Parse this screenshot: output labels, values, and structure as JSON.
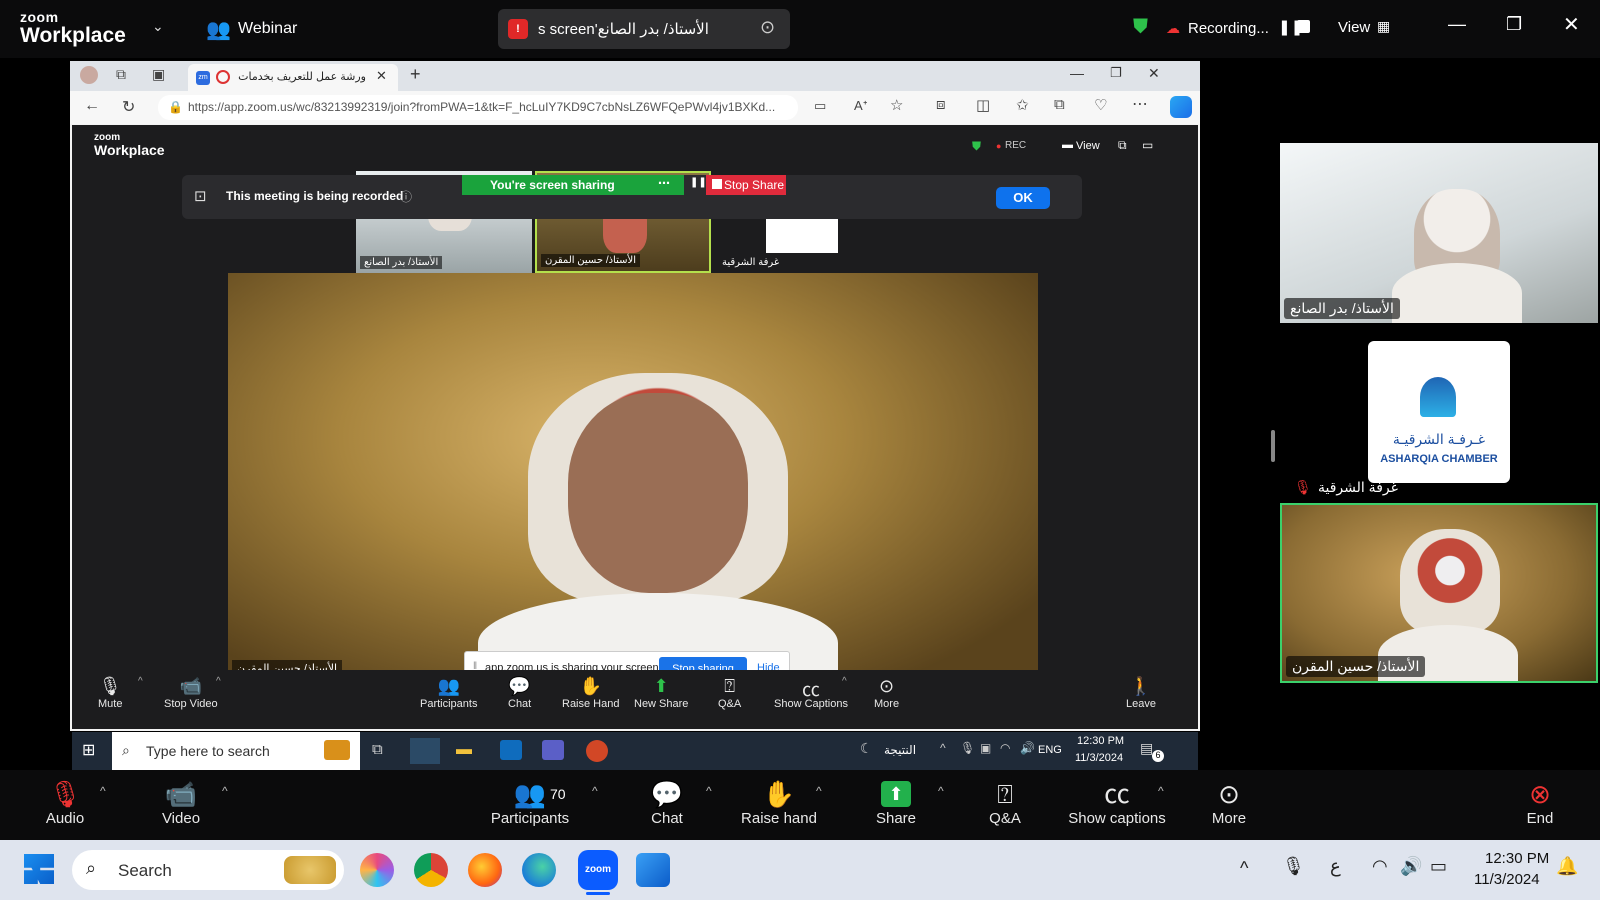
{
  "zoom_top": {
    "logo_top": "zoom",
    "logo_bottom": "Workplace",
    "webinar_label": "Webinar",
    "screen_title": "الأستاذ/ بدر الصانع's screen",
    "recording_label": "Recording...",
    "view_label": "View"
  },
  "browser": {
    "tab_title": "ورشة عمل للتعريف بخدمات",
    "url": "https://app.zoom.us/wc/83213992319/join?fromPWA=1&tk=F_hcLuIY7KD9C7cbNsLZ6WFQePWvl4jv1BXKd..."
  },
  "web_zoom": {
    "logo_top": "zoom",
    "logo_bottom": "Workplace",
    "rec_label": "REC",
    "view_label": "View",
    "sharing_label": "You're screen sharing",
    "stop_share_label": "Stop Share",
    "recorded_notice": "This meeting is being recorded",
    "ok_label": "OK",
    "gallery": [
      {
        "name": "الأستاذ/ بدر الصانع"
      },
      {
        "name": "الأستاذ/ حسين المقرن"
      },
      {
        "name": "غرفة الشرقية"
      }
    ],
    "speaker_name": "الأستاذ/ حسين المقرن",
    "share_notice": "app.zoom.us is sharing your screen.",
    "stop_sharing_label": "Stop sharing",
    "hide_label": "Hide",
    "toolbar": {
      "mute": "Mute",
      "stop_video": "Stop Video",
      "participants": "Participants",
      "chat": "Chat",
      "raise_hand": "Raise Hand",
      "new_share": "New Share",
      "qa": "Q&A",
      "show_captions": "Show Captions",
      "more": "More",
      "leave": "Leave"
    }
  },
  "inner_taskbar": {
    "search_placeholder": "Type here to search",
    "weather": "النتيجة",
    "lang": "ENG",
    "time": "12:30 PM",
    "date": "11/3/2024",
    "notif_count": "6"
  },
  "right_panel": {
    "tiles": [
      {
        "name": "الأستاذ/ بدر الصانع"
      },
      {
        "name": "غرفة الشرقية",
        "logo_ar": "غـرفـة الشرقيـة",
        "logo_en": "ASHARQIA CHAMBER"
      },
      {
        "name": "الأستاذ/ حسين المقرن"
      }
    ]
  },
  "zoom_toolbar": {
    "audio": "Audio",
    "video": "Video",
    "participants": "Participants",
    "participants_count": "70",
    "chat": "Chat",
    "raise_hand": "Raise hand",
    "share": "Share",
    "qa": "Q&A",
    "show_captions": "Show captions",
    "more": "More",
    "end": "End"
  },
  "windows_taskbar": {
    "search_placeholder": "Search",
    "ime": "ع",
    "time": "12:30 PM",
    "date": "11/3/2024"
  }
}
